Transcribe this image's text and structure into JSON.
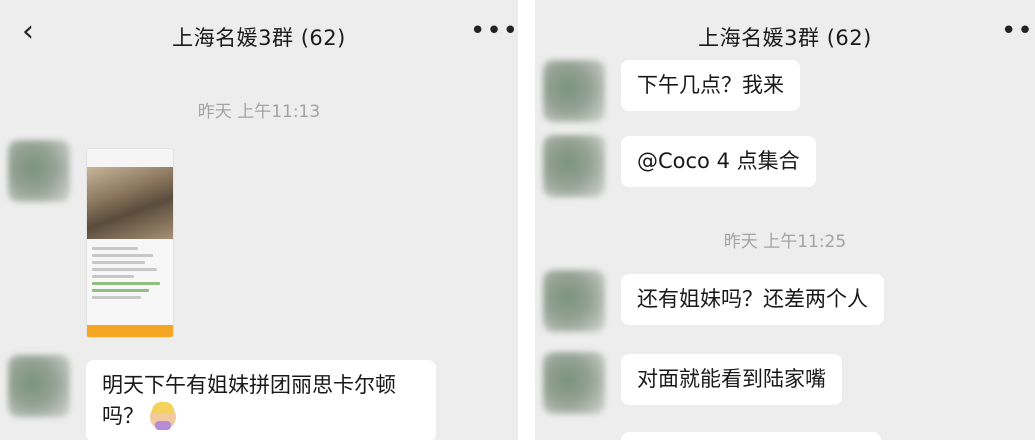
{
  "left": {
    "title": "上海名媛3群 (62)",
    "back_icon": "‹",
    "more_icon": "•••",
    "timestamp": "昨天 上午11:13",
    "message_text": "明天下午有姐妹拼团丽思卡尔顿吗？"
  },
  "right": {
    "title": "上海名媛3群 (62)",
    "more_icon": "•••",
    "messages": [
      {
        "text": "下午几点？我来"
      },
      {
        "text": "@Coco 4 点集合"
      },
      {
        "text": "还有姐妹吗？还差两个人"
      },
      {
        "text": "对面就能看到陆家嘴"
      }
    ],
    "timestamp": "昨天 上午11:25"
  }
}
